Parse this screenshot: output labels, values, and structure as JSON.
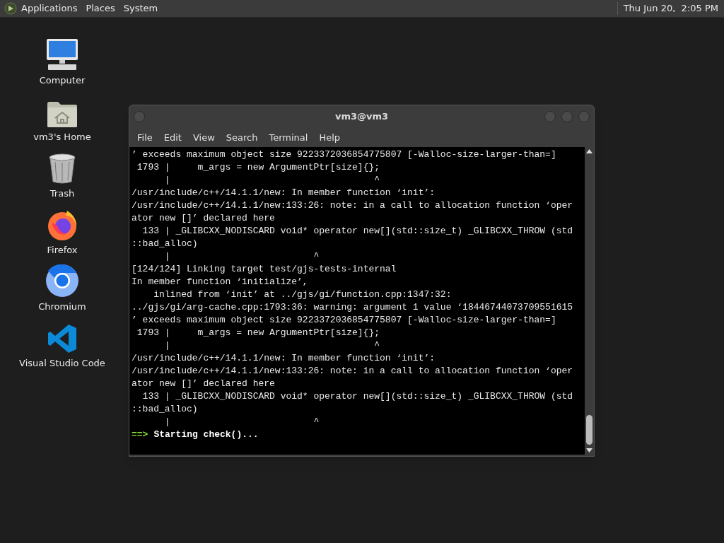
{
  "top_panel": {
    "menus": [
      "Applications",
      "Places",
      "System"
    ],
    "clock": "Thu Jun 20,  2:05 PM"
  },
  "desktop_icons": [
    {
      "label": "Computer",
      "kind": "computer"
    },
    {
      "label": "vm3's Home",
      "kind": "home"
    },
    {
      "label": "Trash",
      "kind": "trash"
    },
    {
      "label": "Firefox",
      "kind": "firefox"
    },
    {
      "label": "Chromium",
      "kind": "chromium"
    },
    {
      "label": "Visual Studio Code",
      "kind": "vscode"
    }
  ],
  "terminal_window": {
    "title": "vm3@vm3",
    "menu": [
      "File",
      "Edit",
      "View",
      "Search",
      "Terminal",
      "Help"
    ],
    "lines": [
      "’ exceeds maximum object size 9223372036854775807 [-Walloc-size-larger-than=]",
      " 1793 |     m_args = new ArgumentPtr[size]{};",
      "      |                                     ^",
      "/usr/include/c++/14.1.1/new: In member function ‘init’:",
      "/usr/include/c++/14.1.1/new:133:26: note: in a call to allocation function ‘oper",
      "ator new []’ declared here",
      "  133 | _GLIBCXX_NODISCARD void* operator new[](std::size_t) _GLIBCXX_THROW (std",
      "::bad_alloc)",
      "      |                          ^",
      "[124/124] Linking target test/gjs-tests-internal",
      "In member function ‘initialize’,",
      "    inlined from ‘init’ at ../gjs/gi/function.cpp:1347:32:",
      "../gjs/gi/arg-cache.cpp:1793:36: warning: argument 1 value ‘18446744073709551615",
      "’ exceeds maximum object size 9223372036854775807 [-Walloc-size-larger-than=]",
      " 1793 |     m_args = new ArgumentPtr[size]{};",
      "      |                                     ^",
      "/usr/include/c++/14.1.1/new: In member function ‘init’:",
      "/usr/include/c++/14.1.1/new:133:26: note: in a call to allocation function ‘oper",
      "ator new []’ declared here",
      "  133 | _GLIBCXX_NODISCARD void* operator new[](std::size_t) _GLIBCXX_THROW (std",
      "::bad_alloc)",
      "      |                          ^"
    ],
    "status_line": {
      "arrow": "==>",
      "message": "Starting check()..."
    }
  }
}
